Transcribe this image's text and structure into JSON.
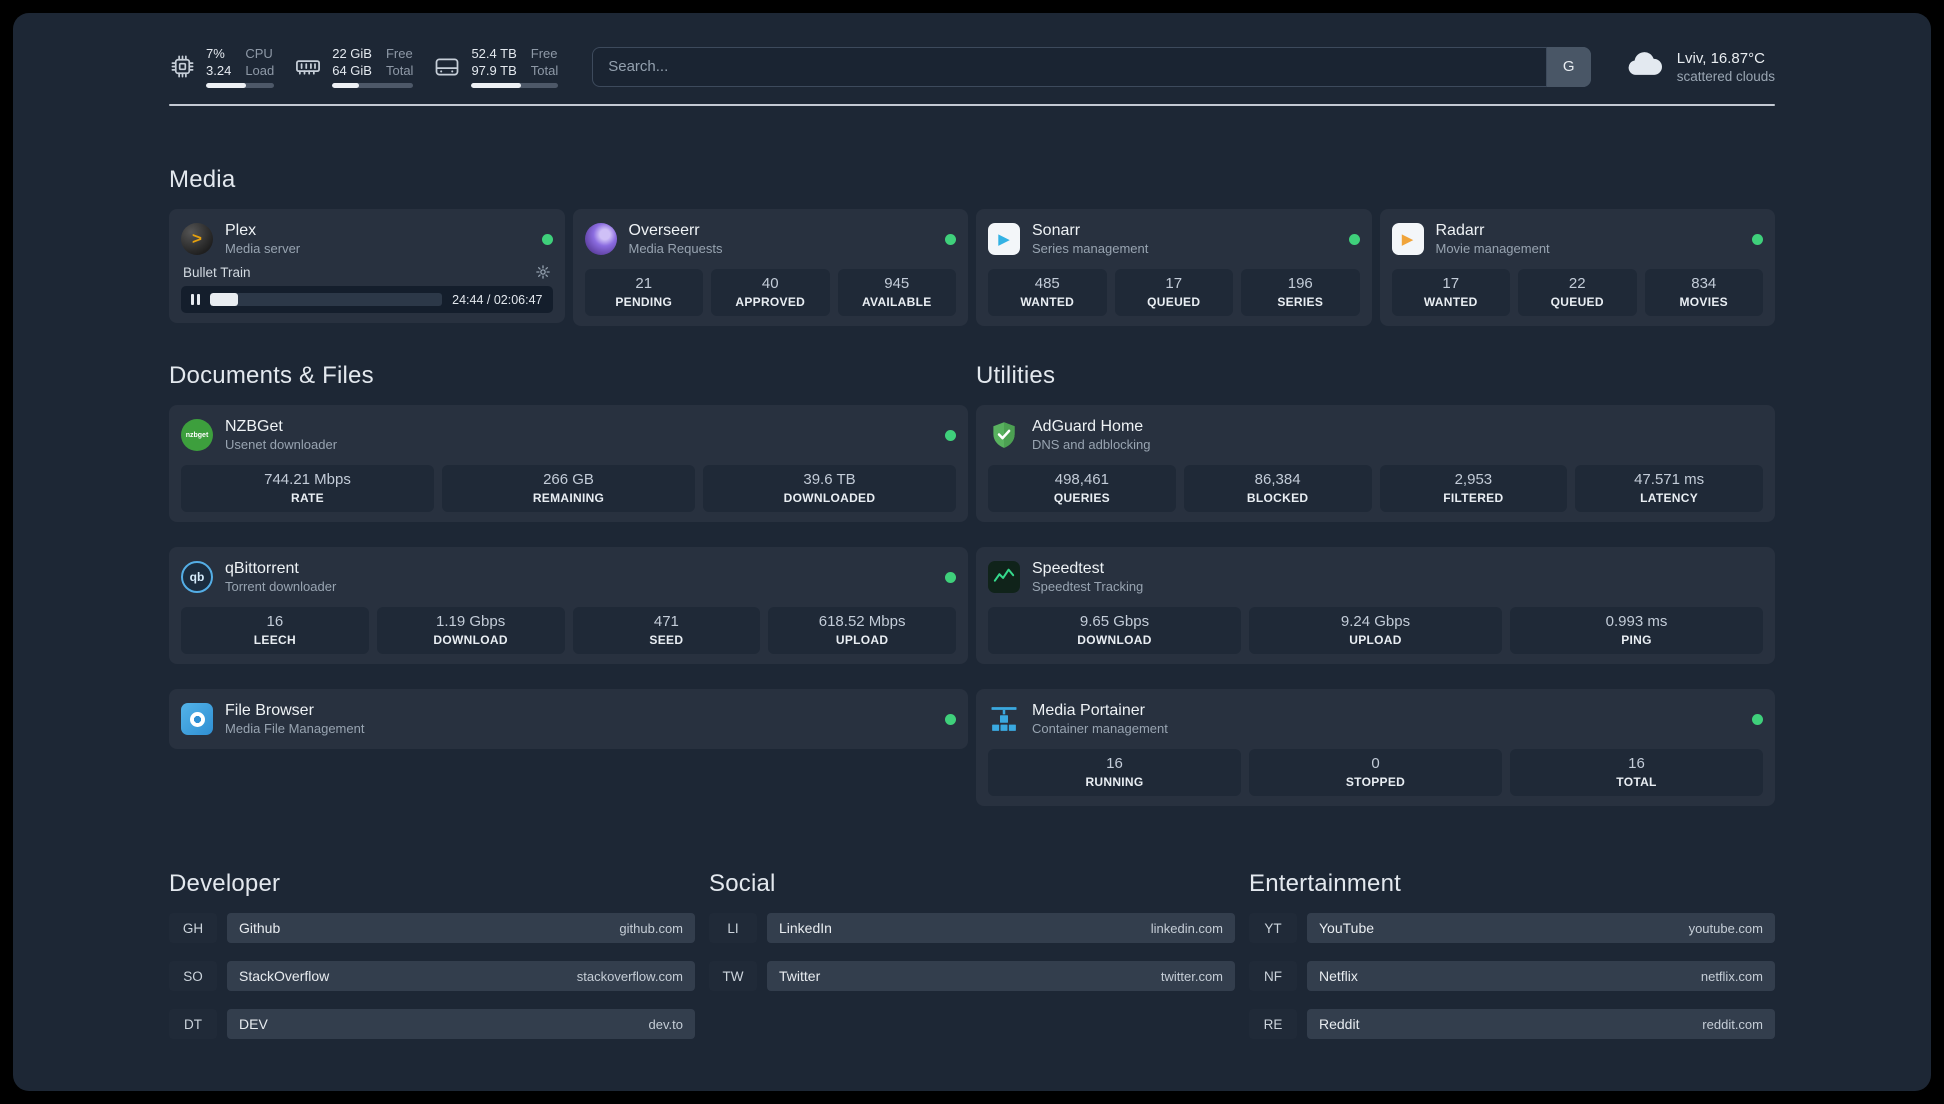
{
  "topbar": {
    "cpu": {
      "value1": "7%",
      "value2": "3.24",
      "label1": "CPU",
      "label2": "Load",
      "bar": "58%"
    },
    "ram": {
      "value1": "22 GiB",
      "value2": "64 GiB",
      "label1": "Free",
      "label2": "Total",
      "bar": "33%"
    },
    "disk": {
      "value1": "52.4 TB",
      "value2": "97.9 TB",
      "label1": "Free",
      "label2": "Total",
      "bar": "57%"
    },
    "search": {
      "placeholder": "Search...",
      "provider": "G"
    },
    "weather": {
      "location": "Lviv, 16.87°C",
      "condition": "scattered clouds"
    }
  },
  "icons": {
    "plex": ">",
    "sonarr": "▶",
    "radarr": "▶",
    "nzbget": "nzbget",
    "qbittorrent": "qb"
  },
  "media": {
    "title": "Media",
    "cards": [
      {
        "name": "Plex",
        "subtitle": "Media server",
        "online": true,
        "player": {
          "title": "Bullet Train",
          "time": "24:44 / 02:06:47",
          "progress": "12%"
        }
      },
      {
        "name": "Overseerr",
        "subtitle": "Media Requests",
        "online": true,
        "stats": [
          {
            "value": "21",
            "label": "PENDING"
          },
          {
            "value": "40",
            "label": "APPROVED"
          },
          {
            "value": "945",
            "label": "AVAILABLE"
          }
        ]
      },
      {
        "name": "Sonarr",
        "subtitle": "Series management",
        "online": true,
        "stats": [
          {
            "value": "485",
            "label": "WANTED"
          },
          {
            "value": "17",
            "label": "QUEUED"
          },
          {
            "value": "196",
            "label": "SERIES"
          }
        ]
      },
      {
        "name": "Radarr",
        "subtitle": "Movie management",
        "online": true,
        "stats": [
          {
            "value": "17",
            "label": "WANTED"
          },
          {
            "value": "22",
            "label": "QUEUED"
          },
          {
            "value": "834",
            "label": "MOVIES"
          }
        ]
      }
    ]
  },
  "documents": {
    "title": "Documents & Files",
    "cards": [
      {
        "name": "NZBGet",
        "subtitle": "Usenet downloader",
        "online": true,
        "stats": [
          {
            "value": "744.21 Mbps",
            "label": "RATE"
          },
          {
            "value": "266 GB",
            "label": "REMAINING"
          },
          {
            "value": "39.6 TB",
            "label": "DOWNLOADED"
          }
        ]
      },
      {
        "name": "qBittorrent",
        "subtitle": "Torrent downloader",
        "online": true,
        "stats": [
          {
            "value": "16",
            "label": "LEECH"
          },
          {
            "value": "1.19 Gbps",
            "label": "DOWNLOAD"
          },
          {
            "value": "471",
            "label": "SEED"
          },
          {
            "value": "618.52 Mbps",
            "label": "UPLOAD"
          }
        ]
      },
      {
        "name": "File Browser",
        "subtitle": "Media File Management",
        "online": true
      }
    ]
  },
  "utilities": {
    "title": "Utilities",
    "cards": [
      {
        "name": "AdGuard Home",
        "subtitle": "DNS and adblocking",
        "online": false,
        "stats": [
          {
            "value": "498,461",
            "label": "QUERIES"
          },
          {
            "value": "86,384",
            "label": "BLOCKED"
          },
          {
            "value": "2,953",
            "label": "FILTERED"
          },
          {
            "value": "47.571 ms",
            "label": "LATENCY"
          }
        ]
      },
      {
        "name": "Speedtest",
        "subtitle": "Speedtest Tracking",
        "online": false,
        "stats": [
          {
            "value": "9.65 Gbps",
            "label": "DOWNLOAD"
          },
          {
            "value": "9.24 Gbps",
            "label": "UPLOAD"
          },
          {
            "value": "0.993 ms",
            "label": "PING"
          }
        ]
      },
      {
        "name": "Media Portainer",
        "subtitle": "Container management",
        "online": true,
        "stats": [
          {
            "value": "16",
            "label": "RUNNING"
          },
          {
            "value": "0",
            "label": "STOPPED"
          },
          {
            "value": "16",
            "label": "TOTAL"
          }
        ]
      }
    ]
  },
  "bookmarks": {
    "groups": [
      {
        "title": "Developer",
        "items": [
          {
            "abbr": "GH",
            "name": "Github",
            "url": "github.com"
          },
          {
            "abbr": "SO",
            "name": "StackOverflow",
            "url": "stackoverflow.com"
          },
          {
            "abbr": "DT",
            "name": "DEV",
            "url": "dev.to"
          }
        ]
      },
      {
        "title": "Social",
        "items": [
          {
            "abbr": "LI",
            "name": "LinkedIn",
            "url": "linkedin.com"
          },
          {
            "abbr": "TW",
            "name": "Twitter",
            "url": "twitter.com"
          }
        ]
      },
      {
        "title": "Entertainment",
        "items": [
          {
            "abbr": "YT",
            "name": "YouTube",
            "url": "youtube.com"
          },
          {
            "abbr": "NF",
            "name": "Netflix",
            "url": "netflix.com"
          },
          {
            "abbr": "RE",
            "name": "Reddit",
            "url": "reddit.com"
          }
        ]
      }
    ]
  },
  "colors": {
    "status_online": "#3fd07b",
    "plex_gold": "#e5a00d",
    "adguard_green": "#59b25f",
    "speedtest_green": "#35d98c",
    "portainer_blue": "#3aa9e0"
  }
}
